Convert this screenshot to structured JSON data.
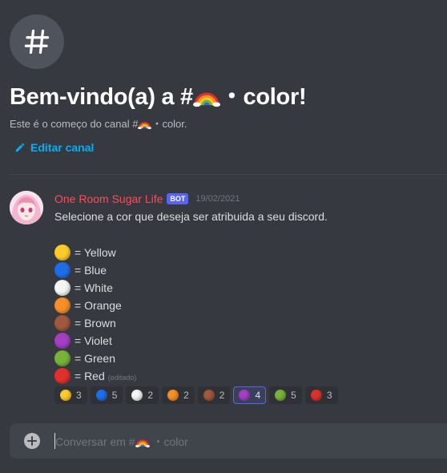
{
  "welcome": {
    "title_prefix": "Bem-vindo(a) a #",
    "title_suffix": "・color!",
    "start_prefix": "Este é o começo do canal #",
    "start_suffix": "・color.",
    "edit_channel": "Editar canal"
  },
  "message": {
    "author": "One Room Sugar Life",
    "badge": "BOT",
    "timestamp": "19/02/2021",
    "text": "Selecione a cor que deseja ser atribuida a seu discord.",
    "edited": "(editado)",
    "colors": [
      {
        "label": "= Yellow",
        "color": "#fdcb29"
      },
      {
        "label": "= Blue",
        "color": "#1f6ee8"
      },
      {
        "label": "= White",
        "color": "#f5f5f5"
      },
      {
        "label": "= Orange",
        "color": "#f68f25"
      },
      {
        "label": "= Brown",
        "color": "#a0583e"
      },
      {
        "label": "= Violet",
        "color": "#a23fc3"
      },
      {
        "label": "= Green",
        "color": "#77b23a"
      },
      {
        "label": "= Red",
        "color": "#e0302c"
      }
    ]
  },
  "reactions": [
    {
      "color": "#fdcb29",
      "count": "3",
      "active": false
    },
    {
      "color": "#1f6ee8",
      "count": "5",
      "active": false
    },
    {
      "color": "#f5f5f5",
      "count": "2",
      "active": false
    },
    {
      "color": "#f68f25",
      "count": "2",
      "active": false
    },
    {
      "color": "#a0583e",
      "count": "2",
      "active": false
    },
    {
      "color": "#a23fc3",
      "count": "4",
      "active": true
    },
    {
      "color": "#77b23a",
      "count": "5",
      "active": false
    },
    {
      "color": "#e0302c",
      "count": "3",
      "active": false
    }
  ],
  "chat": {
    "placeholder_prefix": "Conversar em #",
    "placeholder_suffix": "・color"
  },
  "icons": {
    "hash": "hash-icon",
    "edit": "pencil-icon",
    "add": "plus-icon",
    "rainbow": "rainbow-icon"
  }
}
